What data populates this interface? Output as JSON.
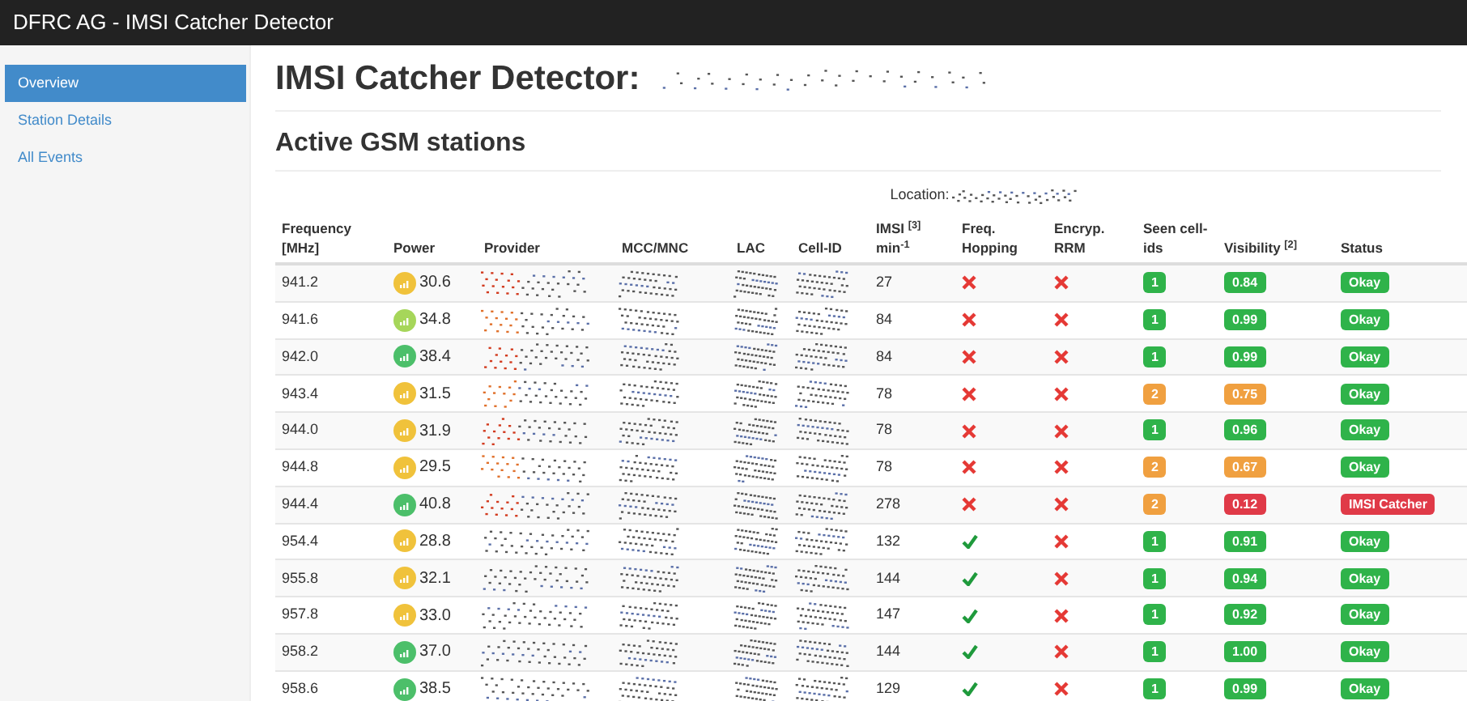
{
  "navbar": {
    "title": "DFRC AG - IMSI Catcher Detector"
  },
  "sidebar": {
    "items": [
      {
        "label": "Overview",
        "selected": true
      },
      {
        "label": "Station Details",
        "selected": false
      },
      {
        "label": "All Events",
        "selected": false
      }
    ]
  },
  "page_title": "IMSI Catcher Detector:",
  "section_title": "Active GSM stations",
  "location_label": "Location:",
  "table": {
    "columns": [
      "Frequency [MHz]",
      "Power",
      "Provider",
      "MCC/MNC",
      "LAC",
      "Cell-ID",
      "IMSI $^{[3]}$ min$^{-1}$",
      "Freq. Hopping",
      "Encryp. RRM",
      "Seen cell-ids",
      "Visibility $^{[2]}$",
      "Status"
    ],
    "rows": [
      {
        "frequency": "941.2",
        "power": {
          "text": "30.6",
          "color": "#f0c23b"
        },
        "imsi": "27",
        "hopping": false,
        "encryption": false,
        "seen": {
          "text": "1",
          "color": "#2fb34a"
        },
        "visibility": {
          "text": "0.84",
          "color": "#2fb34a"
        },
        "status": {
          "text": "Okay",
          "color": "#2fb34a"
        }
      },
      {
        "frequency": "941.6",
        "power": {
          "text": "34.8",
          "color": "#a6d65a"
        },
        "imsi": "84",
        "hopping": false,
        "encryption": false,
        "seen": {
          "text": "1",
          "color": "#2fb34a"
        },
        "visibility": {
          "text": "0.99",
          "color": "#2fb34a"
        },
        "status": {
          "text": "Okay",
          "color": "#2fb34a"
        }
      },
      {
        "frequency": "942.0",
        "power": {
          "text": "38.4",
          "color": "#4cbf6a"
        },
        "imsi": "84",
        "hopping": false,
        "encryption": false,
        "seen": {
          "text": "1",
          "color": "#2fb34a"
        },
        "visibility": {
          "text": "0.99",
          "color": "#2fb34a"
        },
        "status": {
          "text": "Okay",
          "color": "#2fb34a"
        }
      },
      {
        "frequency": "943.4",
        "power": {
          "text": "31.5",
          "color": "#f0c23b"
        },
        "imsi": "78",
        "hopping": false,
        "encryption": false,
        "seen": {
          "text": "2",
          "color": "#f0a040"
        },
        "visibility": {
          "text": "0.75",
          "color": "#f0a040"
        },
        "status": {
          "text": "Okay",
          "color": "#2fb34a"
        }
      },
      {
        "frequency": "944.0",
        "power": {
          "text": "31.9",
          "color": "#f0c23b"
        },
        "imsi": "78",
        "hopping": false,
        "encryption": false,
        "seen": {
          "text": "1",
          "color": "#2fb34a"
        },
        "visibility": {
          "text": "0.96",
          "color": "#2fb34a"
        },
        "status": {
          "text": "Okay",
          "color": "#2fb34a"
        }
      },
      {
        "frequency": "944.8",
        "power": {
          "text": "29.5",
          "color": "#f0c23b"
        },
        "imsi": "78",
        "hopping": false,
        "encryption": false,
        "seen": {
          "text": "2",
          "color": "#f0a040"
        },
        "visibility": {
          "text": "0.67",
          "color": "#f0a040"
        },
        "status": {
          "text": "Okay",
          "color": "#2fb34a"
        }
      },
      {
        "frequency": "944.4",
        "power": {
          "text": "40.8",
          "color": "#4cbf6a"
        },
        "imsi": "278",
        "hopping": false,
        "encryption": false,
        "seen": {
          "text": "2",
          "color": "#f0a040"
        },
        "visibility": {
          "text": "0.12",
          "color": "#e03a48"
        },
        "status": {
          "text": "IMSI Catcher",
          "color": "#e03a48"
        }
      },
      {
        "frequency": "954.4",
        "power": {
          "text": "28.8",
          "color": "#f0c23b"
        },
        "imsi": "132",
        "hopping": true,
        "encryption": false,
        "seen": {
          "text": "1",
          "color": "#2fb34a"
        },
        "visibility": {
          "text": "0.91",
          "color": "#2fb34a"
        },
        "status": {
          "text": "Okay",
          "color": "#2fb34a"
        }
      },
      {
        "frequency": "955.8",
        "power": {
          "text": "32.1",
          "color": "#f0c23b"
        },
        "imsi": "144",
        "hopping": true,
        "encryption": false,
        "seen": {
          "text": "1",
          "color": "#2fb34a"
        },
        "visibility": {
          "text": "0.94",
          "color": "#2fb34a"
        },
        "status": {
          "text": "Okay",
          "color": "#2fb34a"
        }
      },
      {
        "frequency": "957.8",
        "power": {
          "text": "33.0",
          "color": "#f0c23b"
        },
        "imsi": "147",
        "hopping": true,
        "encryption": false,
        "seen": {
          "text": "1",
          "color": "#2fb34a"
        },
        "visibility": {
          "text": "0.92",
          "color": "#2fb34a"
        },
        "status": {
          "text": "Okay",
          "color": "#2fb34a"
        }
      },
      {
        "frequency": "958.2",
        "power": {
          "text": "37.0",
          "color": "#4cbf6a"
        },
        "imsi": "144",
        "hopping": true,
        "encryption": false,
        "seen": {
          "text": "1",
          "color": "#2fb34a"
        },
        "visibility": {
          "text": "1.00",
          "color": "#2fb34a"
        },
        "status": {
          "text": "Okay",
          "color": "#2fb34a"
        }
      },
      {
        "frequency": "958.6",
        "power": {
          "text": "38.5",
          "color": "#4cbf6a"
        },
        "imsi": "129",
        "hopping": true,
        "encryption": false,
        "seen": {
          "text": "1",
          "color": "#2fb34a"
        },
        "visibility": {
          "text": "0.99",
          "color": "#2fb34a"
        },
        "status": {
          "text": "Okay",
          "color": "#2fb34a"
        }
      }
    ]
  }
}
